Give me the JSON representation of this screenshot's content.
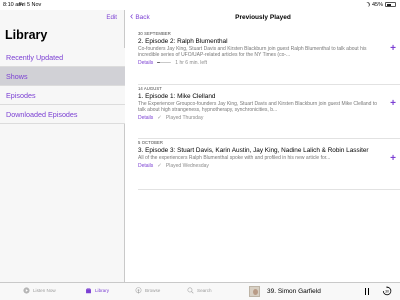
{
  "status": {
    "time": "8:10 am",
    "date": "Fri 5 Nov",
    "battery": "45%"
  },
  "sidebar": {
    "edit_label": "Edit",
    "title": "Library",
    "items": [
      {
        "label": "Recently Updated"
      },
      {
        "label": "Shows",
        "selected": true
      },
      {
        "label": "Episodes"
      },
      {
        "label": "Downloaded Episodes"
      }
    ]
  },
  "main": {
    "back_label": "Back",
    "title": "Previously Played",
    "episodes": [
      {
        "date": "30 SEPTEMBER",
        "title": "2. Episode 2: Ralph Blumenthal",
        "desc": "Co-founders Jay King, Stuart Davis and Kirsten Blackburn join guest Ralph Blumenthal to talk about his incredible series of UFO/UAP-related articles for the NY Times (co-...",
        "details_label": "Details",
        "status": "1 hr 6 min. left",
        "progress": 0.2
      },
      {
        "date": "14 AUGUST",
        "title": "1. Episode 1: Mike Clelland",
        "desc": "The Experiencer Groupco-founders Jay King, Stuart Davis and Kirsten Blackburn join guest Mike Clelland to talk about high strangeness, hypnotherapy, synchronicities, b...",
        "details_label": "Details",
        "status": "Played Thursday"
      },
      {
        "date": "5 OCTOBER",
        "title": "3. Episode 3: Stuart Davis, Karin Austin, Jay King, Nadine Lalich & Robin Lassiter",
        "desc": "All of the experiencers Ralph Blumenthal spoke with and profiled in his new article for...",
        "details_label": "Details",
        "status": "Played Wednesday"
      }
    ]
  },
  "tabbar": {
    "tabs": [
      {
        "label": "Listen Now",
        "icon": "play-circle-icon"
      },
      {
        "label": "Library",
        "icon": "library-icon",
        "selected": true
      },
      {
        "label": "Browse",
        "icon": "podcasts-icon"
      },
      {
        "label": "Search",
        "icon": "search-icon"
      }
    ]
  },
  "player": {
    "title": "39. Simon Garfield"
  },
  "colors": {
    "accent": "#7b3fd3",
    "selected_row": "#d1d1d6"
  }
}
